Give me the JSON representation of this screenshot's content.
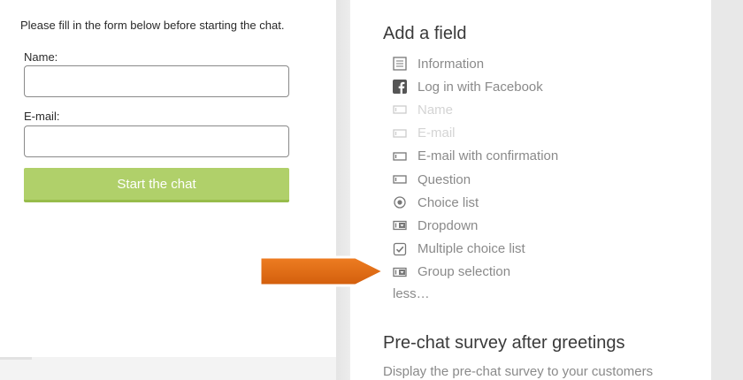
{
  "form_preview": {
    "intro_text": "Please fill in the form  below before starting the chat.",
    "name_label": "Name:",
    "name_value": "",
    "email_label": "E-mail:",
    "email_value": "",
    "submit_label": "Start the chat"
  },
  "add_field": {
    "title": "Add a field",
    "items": [
      {
        "label": "Information",
        "icon": "document-icon",
        "enabled": true
      },
      {
        "label": "Log in with Facebook",
        "icon": "facebook-icon",
        "enabled": true
      },
      {
        "label": "Name",
        "icon": "text-field-icon",
        "enabled": false
      },
      {
        "label": "E-mail",
        "icon": "text-field-icon",
        "enabled": false
      },
      {
        "label": "E-mail with confirmation",
        "icon": "text-field-icon",
        "enabled": true
      },
      {
        "label": "Question",
        "icon": "text-field-icon",
        "enabled": true
      },
      {
        "label": "Choice list",
        "icon": "radio-icon",
        "enabled": true
      },
      {
        "label": "Dropdown",
        "icon": "dropdown-icon",
        "enabled": true
      },
      {
        "label": "Multiple choice list",
        "icon": "checkbox-icon",
        "enabled": true
      },
      {
        "label": "Group selection",
        "icon": "dropdown-icon",
        "enabled": true
      }
    ],
    "less_label": "less…"
  },
  "pre_chat_survey": {
    "title": "Pre-chat survey after greetings",
    "description": "Display the pre-chat survey to your customers"
  },
  "colors": {
    "accent_green": "#b0d06a",
    "annotation_arrow": "#e06a12",
    "muted_text": "#8a8a8a",
    "disabled_text": "#d4d4d4"
  }
}
